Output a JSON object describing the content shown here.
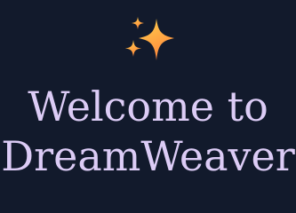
{
  "welcome": {
    "icon": "sparkles-icon",
    "line1": "Welcome to",
    "line2": "DreamWeaver"
  },
  "colors": {
    "background": "#121a2c",
    "title": "#dcccf6",
    "sparkle_light": "#ffd24d",
    "sparkle_dark": "#ff8a3d"
  }
}
